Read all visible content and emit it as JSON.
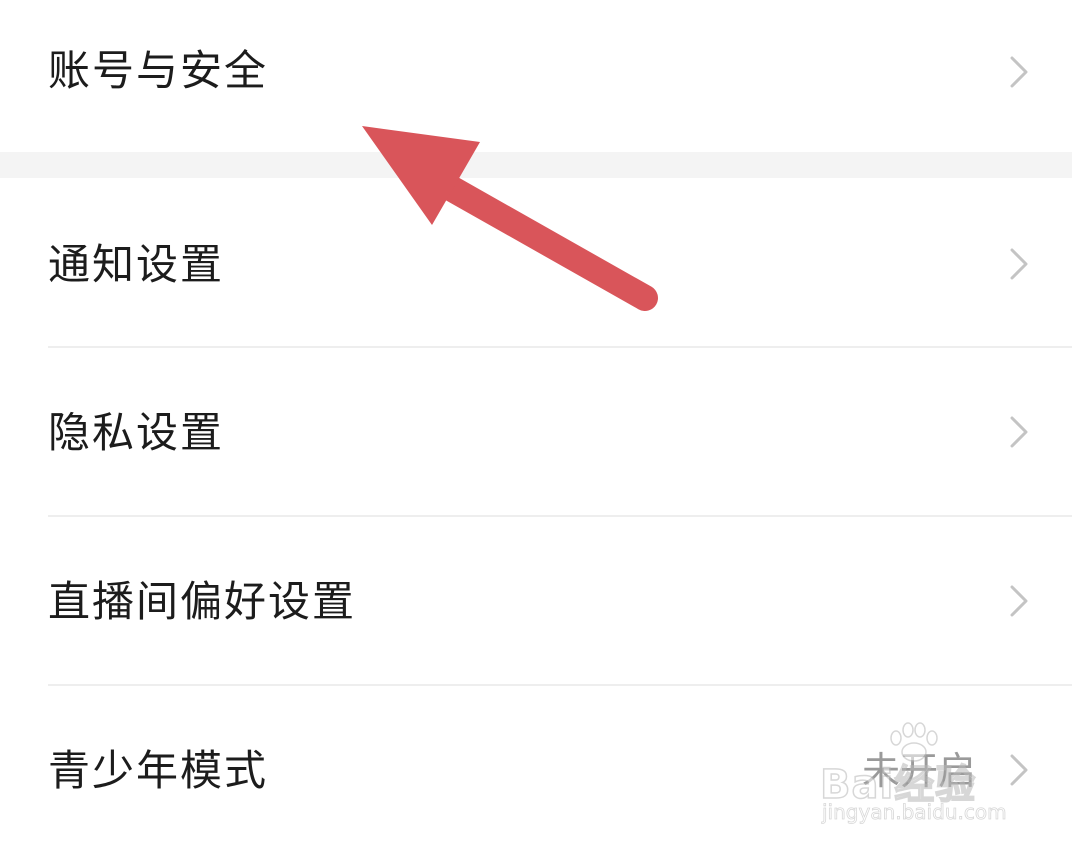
{
  "settings": {
    "items": [
      {
        "label": "账号与安全",
        "value": ""
      },
      {
        "label": "通知设置",
        "value": ""
      },
      {
        "label": "隐私设置",
        "value": ""
      },
      {
        "label": "直播间偏好设置",
        "value": ""
      },
      {
        "label": "青少年模式",
        "value": "未开启"
      }
    ]
  },
  "annotation": {
    "arrow_color": "#d9555a",
    "arrow_target": "账号与安全"
  },
  "watermark": {
    "brand": "Bai经验",
    "url": "jingyan.baidu.com"
  },
  "colors": {
    "background": "#ffffff",
    "section_gap": "#f4f4f4",
    "divider": "#eeeeee",
    "text": "#1c1c1c",
    "secondary_text": "#9a9a9a",
    "chevron": "#c4c4c4"
  }
}
